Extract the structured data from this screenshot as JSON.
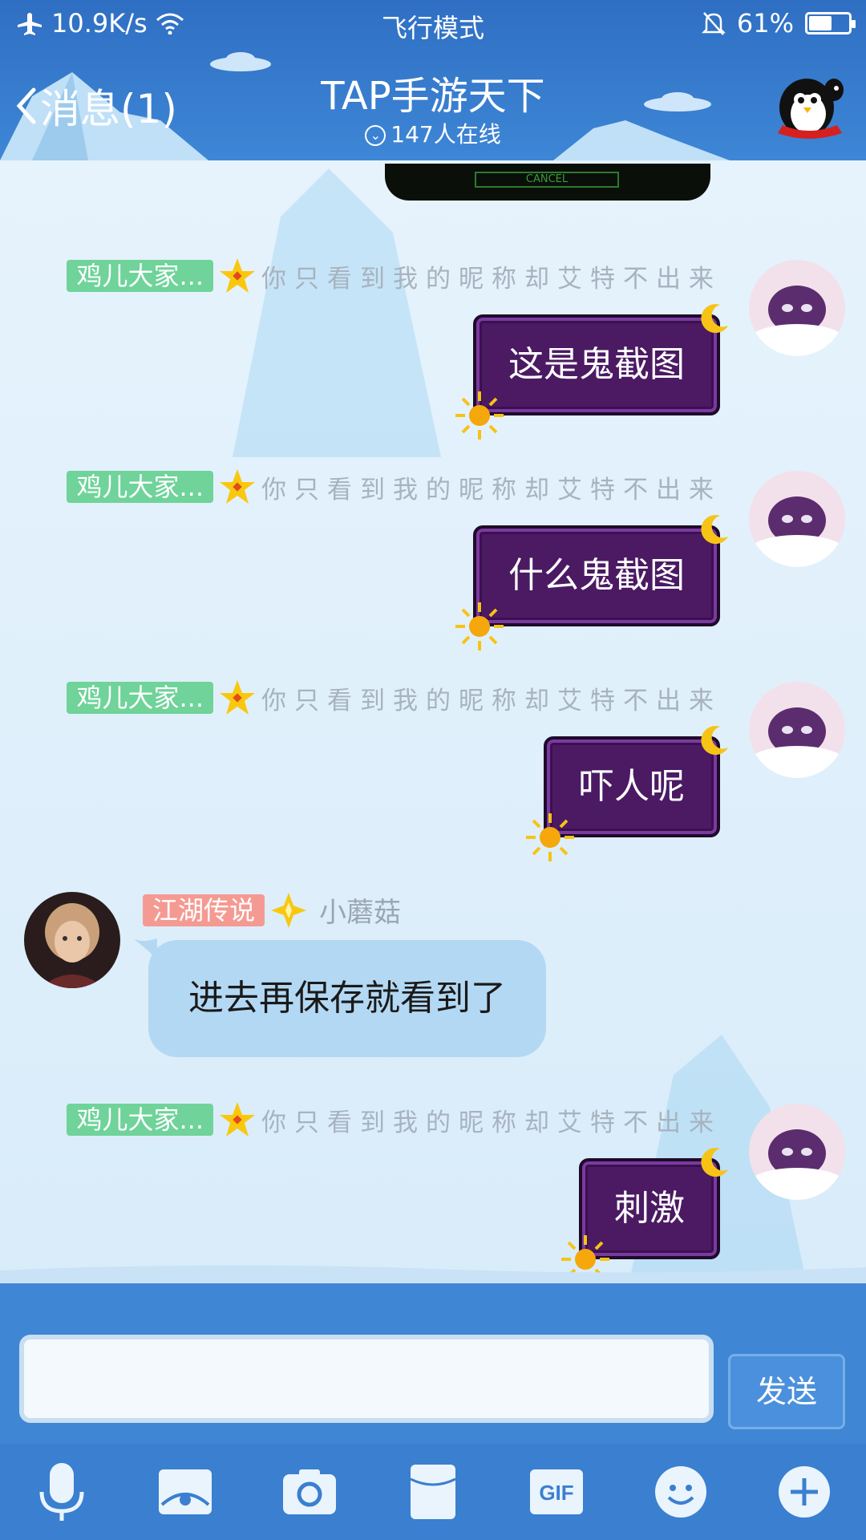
{
  "status": {
    "speed": "10.9K/s",
    "mode": "飞行模式",
    "battery": "61%",
    "battery_level": 0.61
  },
  "header": {
    "back_label": "消息(1)",
    "title": "TAP手游天下",
    "online": "147人在线"
  },
  "shared_image": {
    "button": "CANCEL"
  },
  "self": {
    "tag": "鸡儿大家...",
    "nickname": "你只看到我的昵称却艾特不出来"
  },
  "messages": [
    {
      "text": "这是鬼截图"
    },
    {
      "text": "什么鬼截图"
    },
    {
      "text": "吓人呢"
    },
    {
      "text": "进去再保存就看到了",
      "tag": "江湖传说",
      "nickname": "小蘑菇"
    },
    {
      "text": "刺激"
    }
  ],
  "composer": {
    "value": "",
    "send": "发送"
  },
  "toolbar": [
    "mic-icon",
    "photo-icon",
    "camera-icon",
    "envelope-icon",
    "gif-icon",
    "emoji-icon",
    "plus-icon"
  ],
  "colors": {
    "header": "#3e86d6",
    "bubble_purple": "#4b1a63",
    "bubble_in": "#b3d8f3",
    "tag_green": "#6fd39a",
    "tag_red": "#f59a92"
  }
}
